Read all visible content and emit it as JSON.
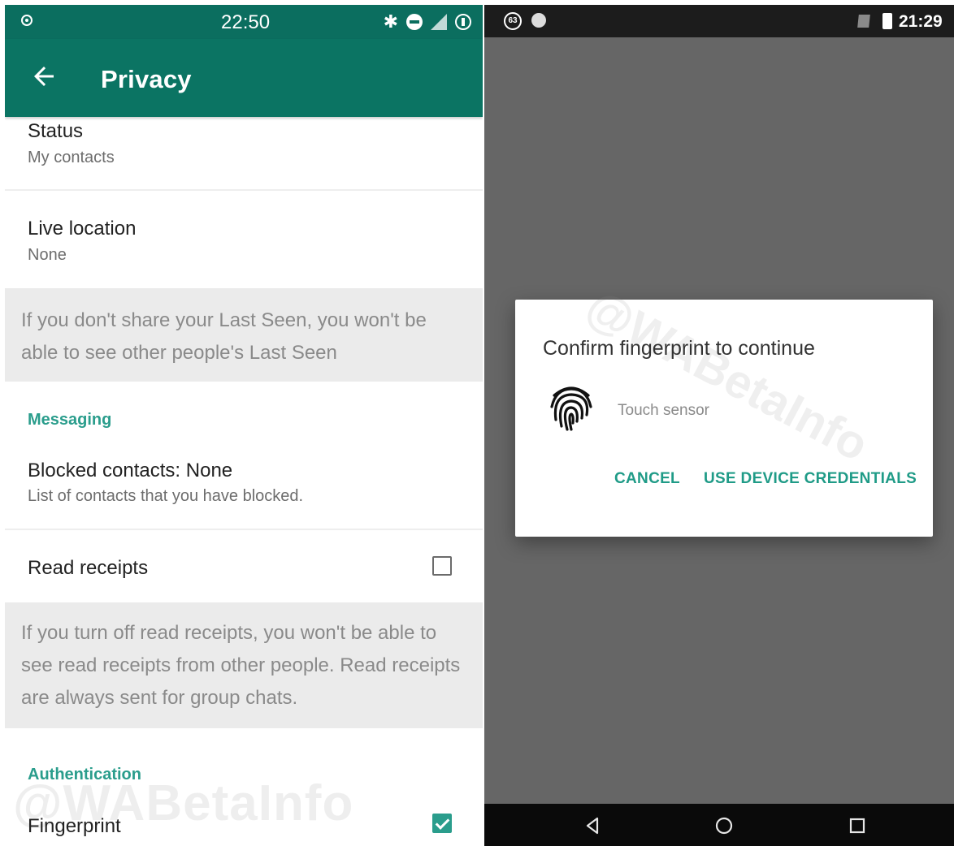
{
  "left_phone": {
    "status_bar": {
      "time": "22:50",
      "icons": [
        "location-icon",
        "bluetooth-icon",
        "do-not-disturb-icon",
        "signal-icon",
        "battery-saver-icon"
      ]
    },
    "toolbar": {
      "title": "Privacy",
      "back_icon": "arrow-left-icon"
    },
    "items": {
      "status": {
        "title": "Status",
        "value": "My contacts"
      },
      "live_location": {
        "title": "Live location",
        "value": "None"
      },
      "last_seen_note": "If you don't share your Last Seen, you won't be able to see other people's Last Seen",
      "messaging_header": "Messaging",
      "blocked": {
        "title": "Blocked contacts: None",
        "subtitle": "List of contacts that you have blocked."
      },
      "read_receipts": {
        "title": "Read receipts",
        "checked": false
      },
      "read_receipts_note": "If you turn off read receipts, you won't be able to see read receipts from other people. Read receipts are always sent for group chats.",
      "auth_header": "Authentication",
      "fingerprint": {
        "title": "Fingerprint",
        "checked": true
      }
    },
    "watermark": "@WABetaInfo"
  },
  "right_phone": {
    "status_bar": {
      "badge": "63",
      "time": "21:29"
    },
    "dialog": {
      "title": "Confirm fingerprint to continue",
      "sensor_label": "Touch sensor",
      "cancel_label": "CANCEL",
      "credentials_label": "USE DEVICE CREDENTIALS",
      "watermark": "@WABetaInfo"
    },
    "nav": [
      "back-icon",
      "home-icon",
      "recents-icon"
    ]
  },
  "colors": {
    "toolbar": "#0b7463",
    "status_bar": "#0b6e5f",
    "accent": "#2a9d8c",
    "scrim": "#666666"
  }
}
